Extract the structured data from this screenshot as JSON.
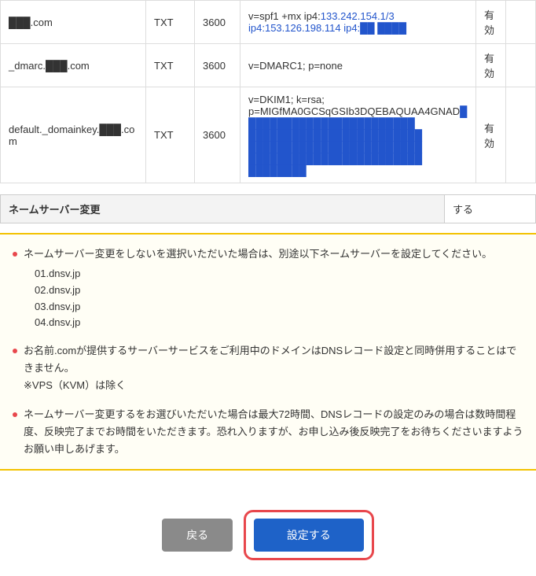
{
  "records": [
    {
      "host": "███.com",
      "type": "TXT",
      "ttl": "3600",
      "value_plain": "v=spf1 +mx ip4:",
      "value_blue": "133.242.154.1/3 ip4:153.126.198.114   ip4:██ ████",
      "status": "有効"
    },
    {
      "host": "_dmarc.███.com",
      "type": "TXT",
      "ttl": "3600",
      "value_plain": "v=DMARC1; p=none",
      "value_blue": "",
      "status": "有効"
    },
    {
      "host": "default._domainkey.███.com",
      "type": "TXT",
      "ttl": "3600",
      "value_plain": "v=DKIM1; k=rsa; p=MIGfMA0GCSqGSIb3DQEBAQUAA4GNAD",
      "value_blue": "████████████████████████ ████████████████████████ ████████████████████████ ████████████████████████ ████████",
      "status": "有効"
    }
  ],
  "ns_change": {
    "label": "ネームサーバー変更",
    "value": "する"
  },
  "notes": {
    "n1": "ネームサーバー変更をしないを選択いただいた場合は、別途以下ネームサーバーを設定してください。",
    "nslist": [
      "01.dnsv.jp",
      "02.dnsv.jp",
      "03.dnsv.jp",
      "04.dnsv.jp"
    ],
    "n2a": "お名前.comが提供するサーバーサービスをご利用中のドメインはDNSレコード設定と同時併用することはできません。",
    "n2b": "※VPS（KVM）は除く",
    "n3": "ネームサーバー変更するをお選びいただいた場合は最大72時間、DNSレコードの設定のみの場合は数時間程度、反映完了までお時間をいただきます。恐れ入りますが、お申し込み後反映完了をお待ちくださいますようお願い申しあげます。"
  },
  "buttons": {
    "back": "戻る",
    "submit": "設定する"
  }
}
